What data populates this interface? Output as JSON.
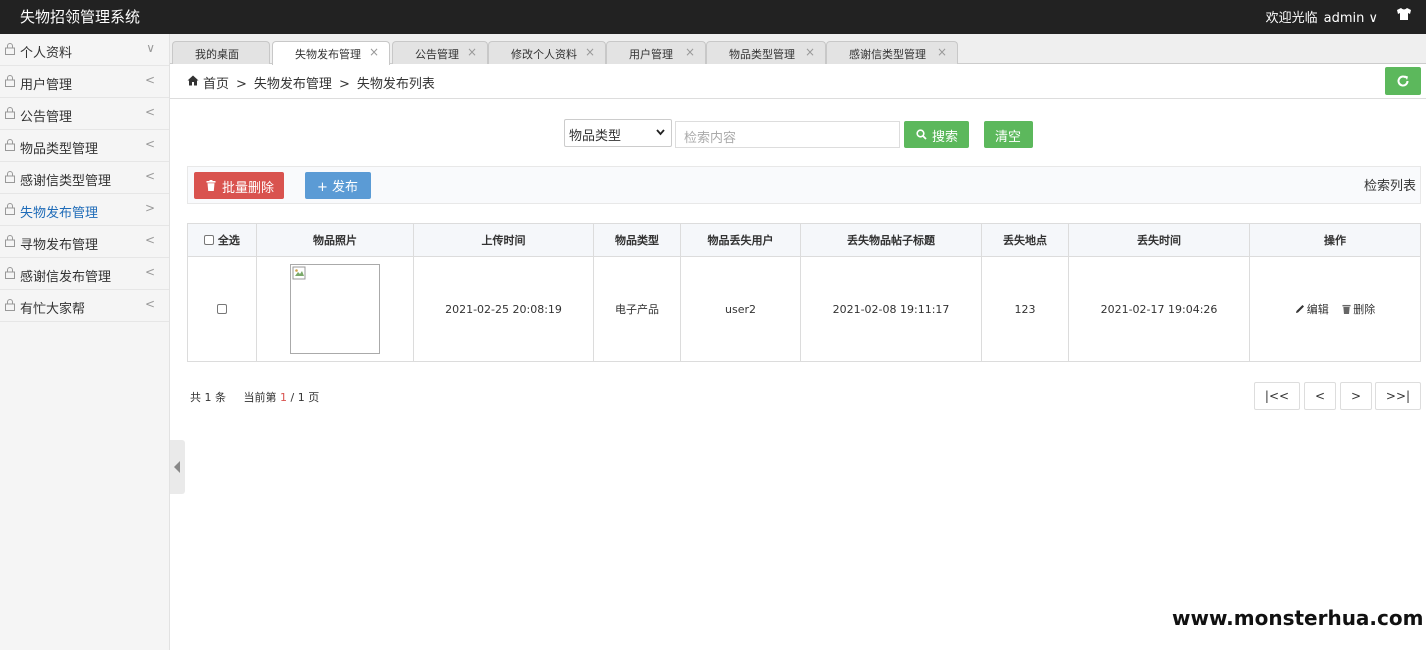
{
  "app": {
    "title": "失物招领管理系统",
    "welcome": "欢迎光临",
    "user": "admin ∨"
  },
  "sidebar": {
    "items": [
      {
        "label": "个人资料",
        "arrow": "∨"
      },
      {
        "label": "用户管理",
        "arrow": "<"
      },
      {
        "label": "公告管理",
        "arrow": "<"
      },
      {
        "label": "物品类型管理",
        "arrow": "<"
      },
      {
        "label": "感谢信类型管理",
        "arrow": "<"
      },
      {
        "label": "失物发布管理",
        "arrow": ">"
      },
      {
        "label": "寻物发布管理",
        "arrow": "<"
      },
      {
        "label": "感谢信发布管理",
        "arrow": "<"
      },
      {
        "label": "有忙大家帮",
        "arrow": "<"
      }
    ]
  },
  "tabs": [
    {
      "label": "我的桌面",
      "close": ""
    },
    {
      "label": "失物发布管理",
      "close": "×"
    },
    {
      "label": "公告管理",
      "close": "×"
    },
    {
      "label": "修改个人资料",
      "close": "×"
    },
    {
      "label": "用户管理",
      "close": "×"
    },
    {
      "label": "物品类型管理",
      "close": "×"
    },
    {
      "label": "感谢信类型管理",
      "close": "×"
    }
  ],
  "breadcrumb": {
    "home": "首页",
    "sep": ">",
    "level1": "失物发布管理",
    "level2": "失物发布列表"
  },
  "search": {
    "select_value": "物品类型",
    "placeholder": "检索内容",
    "search_label": "搜索",
    "clear_label": "清空"
  },
  "toolbar": {
    "batch_delete": "批量删除",
    "publish": "+ 发布",
    "right_text": "检索列表"
  },
  "table": {
    "headers": {
      "select_all": "全选",
      "photo": "物品照片",
      "upload_time": "上传时间",
      "type": "物品类型",
      "user": "物品丢失用户",
      "post_title": "丢失物品帖子标题",
      "place": "丢失地点",
      "lost_time": "丢失时间",
      "ops": "操作"
    },
    "rows": [
      {
        "upload_time": "2021-02-25 20:08:19",
        "type": "电子产品",
        "user": "user2",
        "post_title": "2021-02-08 19:11:17",
        "place": "123",
        "lost_time": "2021-02-17 19:04:26",
        "edit": "编辑",
        "delete": "删除"
      }
    ]
  },
  "pager": {
    "total_prefix": "共",
    "total": "1",
    "total_suffix": "条",
    "current_prefix": "当前第",
    "current": "1",
    "slash": "/",
    "pages": "1",
    "pages_suffix": "页",
    "first": "|<<",
    "prev": "<",
    "next": ">",
    "last": ">>|"
  },
  "watermark": "www.monsterhua.com",
  "colors": {
    "green": "#5cb85c",
    "red": "#d9534f",
    "blue": "#5b9bd5",
    "topbar": "#222222",
    "active_link": "#1e6bb8"
  }
}
